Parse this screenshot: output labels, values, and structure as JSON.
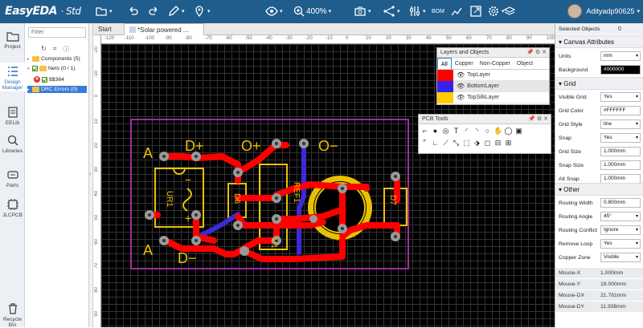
{
  "app": {
    "logo": "EasyEDA",
    "edition": "· Std"
  },
  "toolbar": {
    "zoom": "400%",
    "bom": "BOM",
    "user": "Adityadp90625"
  },
  "left_nav": [
    {
      "label": "Project",
      "icon": "folder-icon"
    },
    {
      "label": "Design Manager",
      "icon": "design-manager-icon"
    },
    {
      "label": "EELib",
      "icon": "eelib-icon"
    },
    {
      "label": "Libraries",
      "icon": "search-library-icon"
    },
    {
      "label": "Parts",
      "icon": "parts-icon"
    },
    {
      "label": "JLCPCB",
      "icon": "jlcpcb-icon"
    },
    {
      "label": "Recycle Bin",
      "icon": "trash-icon"
    }
  ],
  "design_manager": {
    "filter_placeholder": "Filter",
    "tree": [
      {
        "label": "Components (5)"
      },
      {
        "label": "Nets (0 / 1)"
      },
      {
        "label": "$$364"
      },
      {
        "label": "DRC Errors (0)"
      }
    ]
  },
  "tabs": [
    {
      "label": "Start"
    },
    {
      "label": "*Solar powered ..."
    }
  ],
  "ruler_top": [
    "-120",
    "-110",
    "-100",
    "-90",
    "-80",
    "-70",
    "-60",
    "-50",
    "-40",
    "-30",
    "-20",
    "-10",
    "0",
    "10",
    "20",
    "30",
    "40",
    "50",
    "60",
    "70",
    "80",
    "90",
    "100"
  ],
  "ruler_left": [
    "-20",
    "-10",
    "0",
    "10",
    "20",
    "30",
    "40",
    "50",
    "60",
    "70",
    "80",
    "90"
  ],
  "layers_panel": {
    "title": "Layers and Objects",
    "tabs": [
      "All",
      "Copper",
      "Non-Copper",
      "Object"
    ],
    "rows": [
      {
        "name": "TopLayer",
        "color": "#ff0000"
      },
      {
        "name": "BottomLayer",
        "color": "#3322ee"
      },
      {
        "name": "TopSilkLayer",
        "color": "#ffcc00"
      }
    ]
  },
  "pcb_tools": {
    "title": "PCB Tools"
  },
  "pcb_labels": {
    "d_plus": "D+",
    "o_plus": "O+",
    "o_minus": "O−",
    "a_top": "A",
    "a_bot": "A",
    "d_minus": "D−",
    "ur1": "UR1",
    "d6": "D6",
    "u1": "U1",
    "ref1": "REF1",
    "d7": "D7"
  },
  "props": {
    "selected_label": "Selected Objects",
    "selected_count": "0",
    "canvas_section": "Canvas Attributes",
    "units_label": "Units",
    "units": "mm",
    "background_label": "Background",
    "background": "#000000",
    "grid_section": "Grid",
    "visible_grid_label": "Visible Grid",
    "visible_grid": "Yes",
    "grid_color_label": "Grid Color",
    "grid_color": "#FFFFFF",
    "grid_style_label": "Grid Style",
    "grid_style": "line",
    "snap_label": "Snap",
    "snap": "Yes",
    "grid_size_label": "Grid Size",
    "grid_size": "1.000mm",
    "snap_size_label": "Snap Size",
    "snap_size": "1.000mm",
    "alt_snap_label": "Alt Snap",
    "alt_snap": "1.000mm",
    "other_section": "Other",
    "routing_width_label": "Routing Width",
    "routing_width": "0.800mm",
    "routing_angle_label": "Routing Angle",
    "routing_angle": "45°",
    "routing_conflict_label": "Routing Conflict",
    "routing_conflict": "Ignore",
    "remove_loop_label": "Remove Loop",
    "remove_loop": "Yes",
    "copper_zone_label": "Copper Zone",
    "copper_zone": "Visible",
    "mouse_x_label": "Mouse-X",
    "mouse_x": "1.000mm",
    "mouse_y_label": "Mouse-Y",
    "mouse_y": "18.000mm",
    "mouse_dx_label": "Mouse-DX",
    "mouse_dx": "21.781mm",
    "mouse_dy_label": "Mouse-DY",
    "mouse_dy": "11.938mm"
  }
}
